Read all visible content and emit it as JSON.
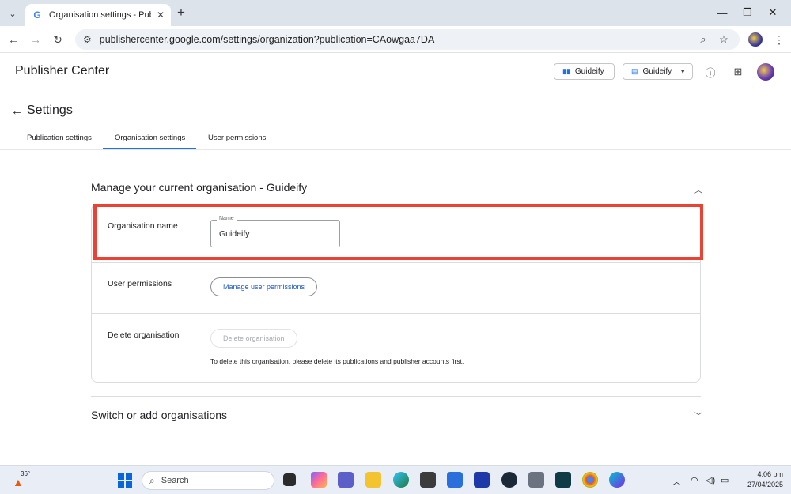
{
  "browser": {
    "tab_title": "Organisation settings - Publishe",
    "url": "publishercenter.google.com/settings/organization?publication=CAowgaa7DA",
    "tab_icon": "G"
  },
  "header": {
    "app_title": "Publisher Center",
    "publication_button": "Guideify",
    "organisation_dropdown": "Guideify"
  },
  "page": {
    "title": "Settings",
    "tabs": [
      {
        "label": "Publication settings"
      },
      {
        "label": "Organisation settings"
      },
      {
        "label": "User permissions"
      }
    ]
  },
  "manage": {
    "section_title": "Manage your current organisation - Guideify",
    "org_name_label": "Organisation name",
    "name_field_label": "Name",
    "name_field_value": "Guideify",
    "user_permissions_label": "User permissions",
    "manage_button": "Manage user permissions",
    "delete_label": "Delete organisation",
    "delete_button": "Delete organisation",
    "delete_helper": "To delete this organisation, please delete its publications and publisher accounts first."
  },
  "switch_section": {
    "title": "Switch or add organisations"
  },
  "taskbar": {
    "weather_temp": "36°",
    "search_placeholder": "Search",
    "time": "4:06 pm",
    "date": "27/04/2025"
  },
  "colors": {
    "accent": "#1a73e8",
    "highlight": "#ea4335"
  }
}
